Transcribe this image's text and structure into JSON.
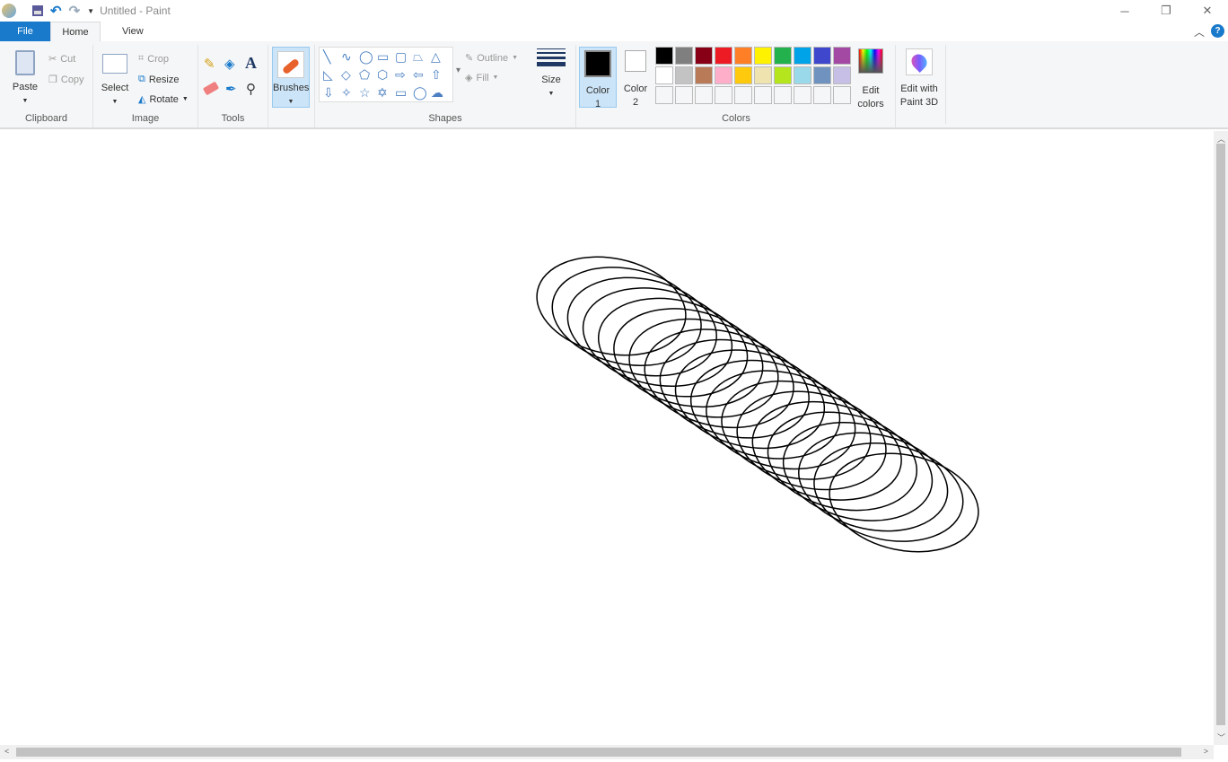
{
  "window": {
    "title": "Untitled - Paint"
  },
  "tabs": [
    {
      "label": "File"
    },
    {
      "label": "Home"
    },
    {
      "label": "View"
    }
  ],
  "clipboard": {
    "label": "Clipboard",
    "paste": "Paste",
    "cut": "Cut",
    "copy": "Copy"
  },
  "image": {
    "label": "Image",
    "select": "Select",
    "crop": "Crop",
    "resize": "Resize",
    "rotate": "Rotate"
  },
  "tools": {
    "label": "Tools"
  },
  "brushes": {
    "label": "Brushes"
  },
  "shapes": {
    "label": "Shapes",
    "outline": "Outline",
    "fill": "Fill"
  },
  "size": {
    "label": "Size"
  },
  "colors": {
    "label": "Colors",
    "color1": "Color",
    "color1_num": "1",
    "color2": "Color",
    "color2_num": "2",
    "edit1": "Edit",
    "edit2": "colors",
    "color1_value": "#000000",
    "color2_value": "#ffffff",
    "row1": [
      "#000000",
      "#7f7f7f",
      "#880015",
      "#ed1c24",
      "#ff7f27",
      "#fff200",
      "#22b14c",
      "#00a2e8",
      "#3f48cc",
      "#a349a4"
    ],
    "row2": [
      "#ffffff",
      "#c3c3c3",
      "#b97a57",
      "#ffaec9",
      "#ffc90e",
      "#efe4b0",
      "#b5e61d",
      "#99d9ea",
      "#7092be",
      "#c8bfe7"
    ],
    "row3": [
      "#f5f6f7",
      "#f5f6f7",
      "#f5f6f7",
      "#f5f6f7",
      "#f5f6f7",
      "#f5f6f7",
      "#f5f6f7",
      "#f5f6f7",
      "#f5f6f7",
      "#f5f6f7"
    ]
  },
  "paint3d": {
    "line1": "Edit with",
    "line2": "Paint 3D"
  }
}
